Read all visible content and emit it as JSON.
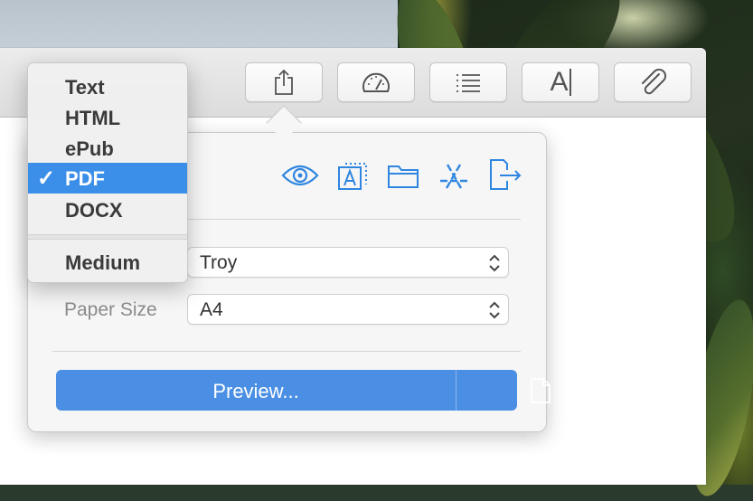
{
  "toolbar": {
    "buttons": [
      {
        "icon": "share-icon"
      },
      {
        "icon": "speedometer-icon"
      },
      {
        "icon": "list-icon"
      },
      {
        "icon": "text-cursor-icon",
        "glyph": "A"
      },
      {
        "icon": "paperclip-icon"
      }
    ]
  },
  "popover": {
    "icons": [
      "eye-icon",
      "text-box-icon",
      "folder-icon",
      "app-store-icon",
      "export-icon"
    ],
    "fields": [
      {
        "label": "",
        "value": "Troy"
      },
      {
        "label": "Paper Size",
        "value": "A4"
      }
    ],
    "preview_label": "Preview...",
    "accent": "#4a8fe3"
  },
  "menu": {
    "items": [
      {
        "label": "Text",
        "selected": false
      },
      {
        "label": "HTML",
        "selected": false
      },
      {
        "label": "ePub",
        "selected": false
      },
      {
        "label": "PDF",
        "selected": true
      },
      {
        "label": "DOCX",
        "selected": false
      }
    ],
    "check_glyph": "✓",
    "size_label": "Medium",
    "selection_color": "#3b8fe8"
  }
}
